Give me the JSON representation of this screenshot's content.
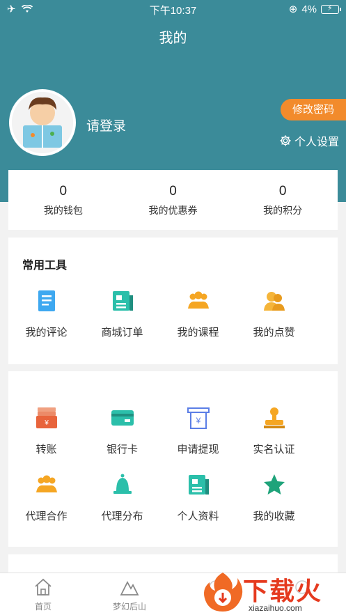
{
  "status_bar": {
    "time": "下午10:37",
    "battery": "4%"
  },
  "page": {
    "title": "我的"
  },
  "profile": {
    "login_text": "请登录",
    "change_password": "修改密码",
    "settings": "个人设置"
  },
  "stats": [
    {
      "value": "0",
      "label": "我的钱包"
    },
    {
      "value": "0",
      "label": "我的优惠券"
    },
    {
      "value": "0",
      "label": "我的积分"
    }
  ],
  "tools": {
    "title": "常用工具",
    "items": [
      {
        "label": "我的评论",
        "icon": "comment-icon"
      },
      {
        "label": "商城订单",
        "icon": "order-icon"
      },
      {
        "label": "我的课程",
        "icon": "course-icon"
      },
      {
        "label": "我的点赞",
        "icon": "like-icon"
      }
    ]
  },
  "services": {
    "items": [
      {
        "label": "转账",
        "icon": "transfer-icon"
      },
      {
        "label": "银行卡",
        "icon": "bank-card-icon"
      },
      {
        "label": "申请提现",
        "icon": "withdraw-icon"
      },
      {
        "label": "实名认证",
        "icon": "verify-icon"
      },
      {
        "label": "代理合作",
        "icon": "agent-icon"
      },
      {
        "label": "代理分布",
        "icon": "bell-icon"
      },
      {
        "label": "个人资料",
        "icon": "profile-icon"
      },
      {
        "label": "我的收藏",
        "icon": "star-icon"
      }
    ]
  },
  "tabbar": [
    {
      "label": "首页",
      "icon": "home-icon"
    },
    {
      "label": "梦幻后山",
      "icon": "mountain-icon"
    },
    {
      "label": "",
      "icon": "tab-icon"
    },
    {
      "label": "",
      "icon": "tab-icon"
    }
  ],
  "watermark": {
    "text": "下载火",
    "url": "xiazaihuo.com"
  },
  "colors": {
    "header": "#3b8b99",
    "accent": "#f28b2c"
  }
}
